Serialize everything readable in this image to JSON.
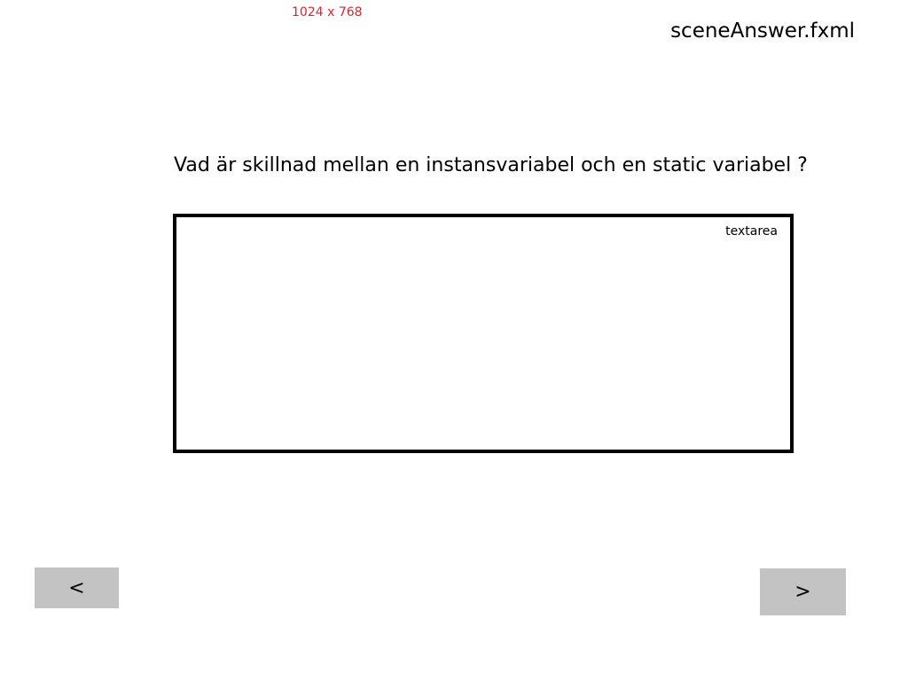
{
  "header": {
    "dimension_note": "1024 x 768",
    "file_name": "sceneAnswer.fxml"
  },
  "main": {
    "question": "Vad är skillnad mellan en instansvariabel och en static variabel ?",
    "answer_box": {
      "label": "textarea",
      "value": ""
    }
  },
  "navigation": {
    "prev_label": "<",
    "next_label": ">"
  },
  "colors": {
    "background": "#ffffff",
    "dimension_note": "#d9262c",
    "button_background": "#c3c3c3",
    "border": "#000000"
  }
}
